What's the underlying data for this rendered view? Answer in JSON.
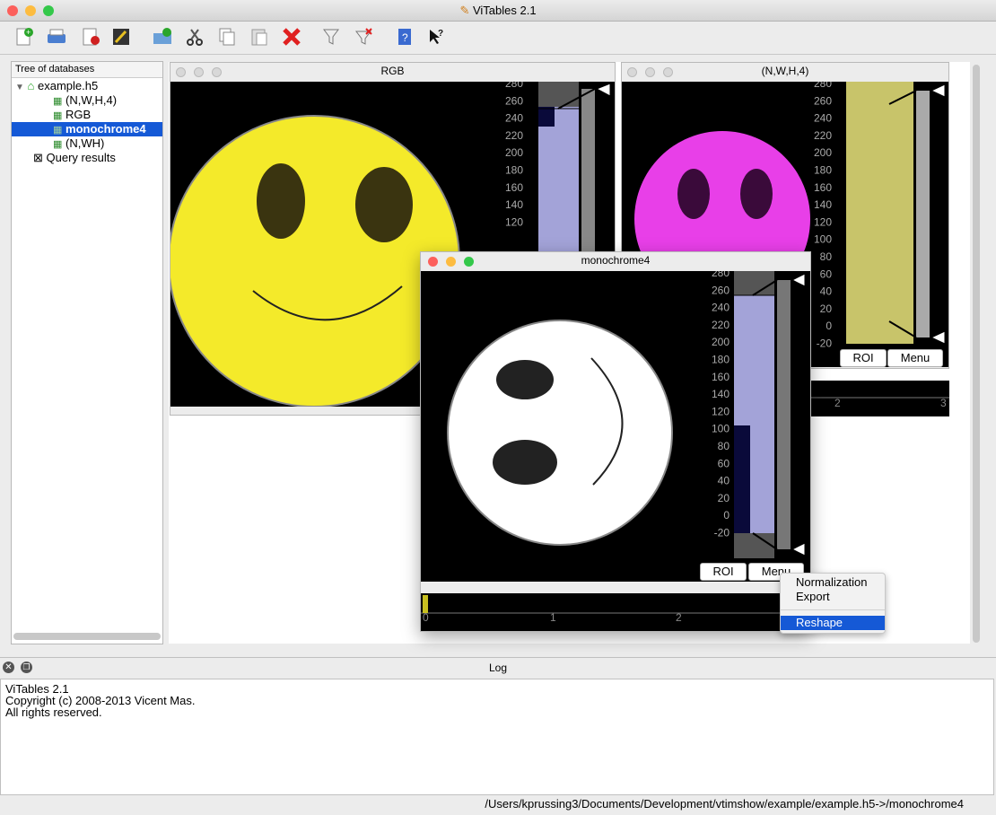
{
  "app": {
    "title": "ViTables 2.1",
    "light_colors": [
      "#fc605c",
      "#fdbc40",
      "#34c84a"
    ]
  },
  "toolbar": [
    "new-file-icon",
    "open-file-icon",
    "close-file-icon",
    "save-as-icon",
    "new-group-icon",
    "cut-icon",
    "copy-icon",
    "paste-icon",
    "delete-icon",
    "query-icon",
    "delete-queries-icon",
    "about-icon",
    "whats-this-icon"
  ],
  "tree": {
    "header": "Tree of databases",
    "file": "example.h5",
    "items": [
      "(N,W,H,4)",
      "RGB",
      "monochrome4",
      "(N,WH)"
    ],
    "query": "Query results",
    "selected_index": 2
  },
  "windows": {
    "rgb": {
      "title": "RGB",
      "ticks": [
        "280",
        "260",
        "240",
        "220",
        "200",
        "180",
        "160",
        "140",
        "120"
      ]
    },
    "nwh4": {
      "title": "(N,W,H,4)",
      "ticks": [
        "280",
        "260",
        "240",
        "220",
        "200",
        "180",
        "160",
        "140",
        "120",
        "100",
        "80",
        "60",
        "40",
        "20",
        "0",
        "-20"
      ],
      "roi": "ROI",
      "menu": "Menu",
      "timeline_ticks": [
        "2",
        "3"
      ]
    },
    "mono": {
      "title": "monochrome4",
      "ticks": [
        "280",
        "260",
        "240",
        "220",
        "200",
        "180",
        "160",
        "140",
        "120",
        "100",
        "80",
        "60",
        "40",
        "20",
        "0",
        "-20"
      ],
      "roi": "ROI",
      "menu": "Menu",
      "timeline_ticks": [
        "0",
        "1",
        "2"
      ]
    }
  },
  "context_menu": {
    "items": [
      "Normalization",
      "Export",
      "Reshape"
    ],
    "selected": "Reshape"
  },
  "log": {
    "title": "Log",
    "lines": [
      "ViTables 2.1",
      "Copyright (c) 2008-2013 Vicent Mas.",
      "All rights reserved."
    ]
  },
  "status": {
    "path": "/Users/kprussing3/Documents/Development/vtimshow/example/example.h5->/monochrome4"
  },
  "colors": {
    "selection": "#1559d6",
    "yellow": "#f4ea2a",
    "magenta": "#e83fe8",
    "histo": "#a3a3d8",
    "olive": "#c8c46a"
  }
}
